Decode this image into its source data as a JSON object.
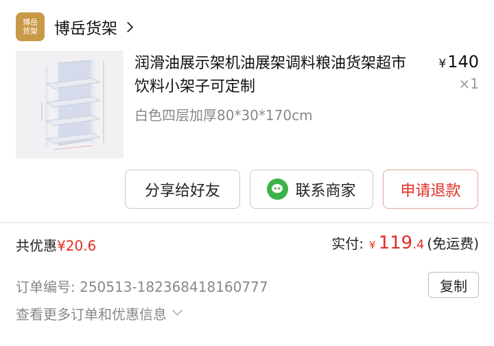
{
  "shop": {
    "logo_text": "博岳\n货架",
    "name": "博岳货架",
    "chevron_icon": "chevron-right-icon"
  },
  "product": {
    "image_icon": "shelf-product-image",
    "title": "润滑油展示架机油展架调料粮油货架超市饮料小架子可定制",
    "spec": "白色四层加厚80*30*170cm",
    "price_symbol": "¥",
    "price": "140",
    "quantity": "×1"
  },
  "actions": {
    "share_label": "分享给好友",
    "contact_label": "联系商家",
    "contact_icon": "wechat-icon",
    "refund_label": "申请退款"
  },
  "summary": {
    "discount_label": "共优惠",
    "discount_value": "¥20.6",
    "paid_label": "实付:",
    "paid_symbol": "¥",
    "paid_int": "119",
    "paid_dec": ".4",
    "shipping_note": "(免运费)"
  },
  "order": {
    "number_label": "订单编号:",
    "number_value": "250513-182368418160777",
    "copy_label": "复制",
    "more_label": "查看更多订单和优惠信息",
    "more_icon": "chevron-down-icon"
  },
  "colors": {
    "accent_red": "#e02e24",
    "logo_gold": "#c89a48",
    "wechat_green": "#3cb34a"
  }
}
